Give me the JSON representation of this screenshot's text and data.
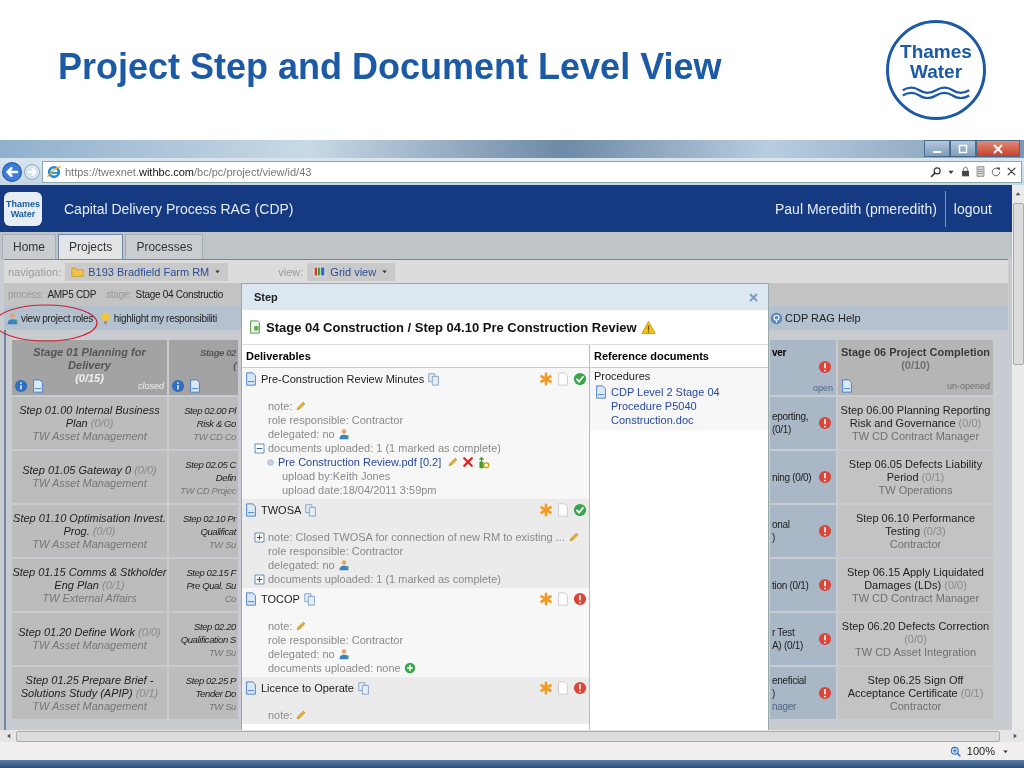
{
  "slide": {
    "title": "Project Step and Document Level View",
    "logo": {
      "line1": "Thames",
      "line2": "Water"
    }
  },
  "browser": {
    "url": "https://twexnet.**withbc.com**/bc/pc/project/view/id/43",
    "zoom": "100%"
  },
  "app": {
    "title": "Capital Delivery Process RAG (CDP)",
    "user": "Paul Meredith (pmeredith)",
    "logout": "logout",
    "logo": {
      "line1": "Thames",
      "line2": "Water"
    }
  },
  "tabs": [
    {
      "label": "Home",
      "selected": false
    },
    {
      "label": "Projects",
      "selected": true
    },
    {
      "label": "Processes",
      "selected": false
    }
  ],
  "navigation": {
    "label": "navigation:",
    "project": "B193 Bradfield Farm RM",
    "view_label": "view:",
    "view": "Grid view"
  },
  "process_bar": {
    "process_label": "process:",
    "process": "AMP5 CDP",
    "stage_label": "stage:",
    "stage": "Stage 04 Constructio"
  },
  "toolbar": {
    "left": [
      {
        "label": "view project roles",
        "kind": "roles"
      },
      {
        "label": "highlight my responsibiliti",
        "kind": "highlight"
      }
    ],
    "right": [
      {
        "label": "CDP RAG Help",
        "kind": "help"
      }
    ]
  },
  "grid": {
    "columns": [
      {
        "kind": "full",
        "closed": true,
        "active": false,
        "title": "Stage 01 Planning for Delivery",
        "count": "(0/15)",
        "state": "closed",
        "info": true,
        "steps": [
          {
            "name": "Step 01.00 Internal Business Plan",
            "count": "(0/0)",
            "owner": "TW Asset Management"
          },
          {
            "name": "Step 01.05 Gateway 0",
            "count": "(0/0)",
            "owner": "TW Asset Management"
          },
          {
            "name": "Step 01.10 Optimisation Invest. Prog.",
            "count": "(0/0)",
            "owner": "TW Asset Management"
          },
          {
            "name": "Step 01.15 Comms & Stkholder Eng Plan",
            "count": "(0/1)",
            "owner": "TW External Affairs"
          },
          {
            "name": "Step 01.20 Define Work",
            "count": "(0/0)",
            "owner": "TW Asset Management"
          },
          {
            "name": "Step 01.25 Prepare Brief - Solutions Study (APIP)",
            "count": "(0/1)",
            "owner": "TW Asset Management"
          }
        ]
      },
      {
        "kind": "cut_right",
        "closed": true,
        "active": false,
        "title_lines": [
          "Stage 02",
          "("
        ],
        "info": true,
        "steps": [
          {
            "lines": [
              "Step 02.00 Pl",
              "Risk & Go"
            ],
            "owner": "TW CD Co"
          },
          {
            "lines": [
              "Step 02.05 C",
              "Defin"
            ],
            "owner": "TW CD Projec"
          },
          {
            "lines": [
              "Step 02.10 Pr",
              "Qualificat"
            ],
            "owner": "TW Su"
          },
          {
            "lines": [
              "Step 02.15 F",
              "Pre Qual. Su"
            ],
            "owner": "Co"
          },
          {
            "lines": [
              "Step 02.20",
              "Qualification S"
            ],
            "owner": "TW Su"
          },
          {
            "lines": [
              "Step 02.25 P",
              "Tender Do"
            ],
            "owner": "TW Su"
          }
        ]
      },
      {
        "kind": "cut_left",
        "closed": false,
        "active": true,
        "title_lines": [
          "ver"
        ],
        "state": "open",
        "alert": true,
        "steps": [
          {
            "lines": [
              "eporting,",
              "(0/1)"
            ],
            "alert": true
          },
          {
            "lines": [
              "ning (0/0)"
            ],
            "alert": true
          },
          {
            "lines": [
              "onal",
              ")"
            ],
            "alert": true
          },
          {
            "lines": [
              "tion (0/1)"
            ],
            "alert": true
          },
          {
            "lines": [
              "r Test",
              "A) (0/1)"
            ],
            "alert": true
          },
          {
            "lines": [
              "eneficial",
              ")"
            ],
            "owner": "nager",
            "alert": true
          }
        ]
      },
      {
        "kind": "full",
        "closed": false,
        "active": false,
        "title": "Stage 06 Project Completion",
        "count": "(0/10)",
        "state": "un-opened",
        "info": false,
        "steps": [
          {
            "name": "Step 06.00 Planning Reporting Risk and Governance",
            "count": "(0/0)",
            "owner": "TW CD Contract Manager"
          },
          {
            "name": "Step 06.05 Defects Liability Period",
            "count": "(0/1)",
            "owner": "TW Operations"
          },
          {
            "name": "Step 06.10 Performance Testing",
            "count": "(0/3)",
            "owner": "Contractor"
          },
          {
            "name": "Step 06.15 Apply Liquidated Damages (LDs)",
            "count": "(0/0)",
            "owner": "TW CD Contract Manager"
          },
          {
            "name": "Step 06.20 Defects Correction",
            "count": "(0/0)",
            "owner": "TW CD Asset Integration"
          },
          {
            "name": "Step 06.25 Sign Off Acceptance Certificate",
            "count": "(0/1)",
            "owner": "Contractor"
          }
        ]
      }
    ]
  },
  "modal": {
    "title": "Step",
    "heading": "Stage 04 Construction / Step 04.10 Pre Construction Review",
    "warning": true,
    "deliverables_header": "Deliverables",
    "reference_header": "Reference documents",
    "deliverables": [
      {
        "title": "Pre-Construction Review Minutes",
        "complete": true,
        "note": "note:",
        "role": "role responsible: Contractor",
        "delegated": "delegated: no",
        "documents": "documents uploaded: 1 (1 marked as complete)",
        "documents_expanded": true,
        "files": [
          {
            "name": "Pre Construction Review.pdf [0.2]",
            "uploaded_by": "upload by:Keith Jones",
            "upload_date": "upload date:18/04/2011 3:59pm"
          }
        ]
      },
      {
        "title": "TWOSA",
        "complete": true,
        "note": "note: Closed TWOSA for connection of new RM to existing ...",
        "note_expanded": false,
        "role": "role responsible: Contractor",
        "delegated": "delegated: no",
        "documents": "documents uploaded: 1 (1 marked as complete)",
        "documents_expanded": false
      },
      {
        "title": "TOCOP",
        "complete": false,
        "note": "note:",
        "role": "role responsible: Contractor",
        "delegated": "delegated: no",
        "documents": "documents uploaded: none",
        "can_add": true
      },
      {
        "title": "Licence to Operate",
        "complete": false,
        "note": "note:"
      }
    ],
    "reference_groups": [
      {
        "title": "Procedures",
        "documents": [
          "CDP Level 2 Stage 04 Procedure P5040 Construction.doc"
        ]
      }
    ]
  }
}
